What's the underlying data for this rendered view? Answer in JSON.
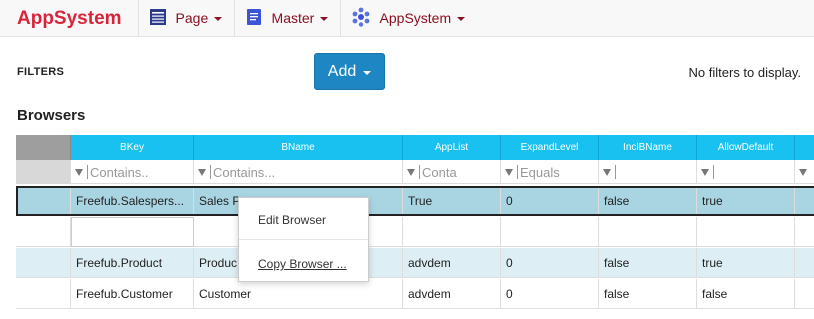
{
  "nav": {
    "brand": "AppSystem",
    "items": [
      {
        "label": "Page",
        "icon": "page-grid-icon"
      },
      {
        "label": "Master",
        "icon": "master-doc-icon"
      },
      {
        "label": "AppSystem",
        "icon": "appsystem-network-icon"
      }
    ]
  },
  "filters": {
    "label": "FILTERS",
    "add_label": "Add",
    "empty_text": "No filters to display."
  },
  "section": {
    "title": "Browsers"
  },
  "grid": {
    "columns": [
      "BKey",
      "BName",
      "AppList",
      "ExpandLevel",
      "InclBName",
      "AllowDefault"
    ],
    "filter_placeholders": [
      "Contains..",
      "Contains...",
      "Conta",
      "Equals",
      "",
      ""
    ],
    "rows": [
      {
        "bkey": "Freefub.Salespers...",
        "bname": "Sales P",
        "applist": "True",
        "expandlevel": "0",
        "inclbname": "false",
        "allowdefault": "true"
      },
      {
        "bkey": "",
        "bname": "",
        "applist": "",
        "expandlevel": "",
        "inclbname": "",
        "allowdefault": ""
      },
      {
        "bkey": "Freefub.Product",
        "bname": "Produc",
        "applist": "advdem",
        "expandlevel": "0",
        "inclbname": "false",
        "allowdefault": "true"
      },
      {
        "bkey": "Freefub.Customer",
        "bname": "Customer",
        "applist": "advdem",
        "expandlevel": "0",
        "inclbname": "false",
        "allowdefault": "false"
      }
    ]
  },
  "context_menu": {
    "items": [
      "Edit Browser",
      "Copy Browser ..."
    ]
  },
  "colors": {
    "brand": "#d6243a",
    "header": "#19c1f0",
    "selected_row": "#a9d5e3",
    "alt_row": "#ddeef4",
    "add_button": "#1f86c4"
  }
}
